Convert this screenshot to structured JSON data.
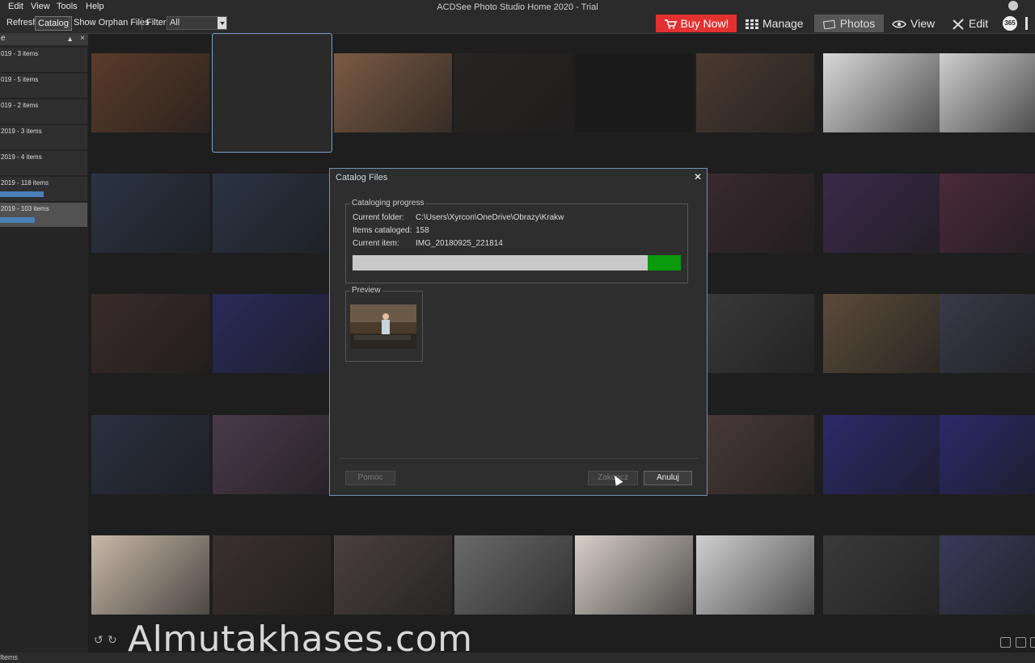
{
  "menu": [
    "Edit",
    "View",
    "Tools",
    "Help"
  ],
  "app_title": "ACDSee Photo Studio Home 2020 - Trial",
  "toolbar": {
    "refresh": "Refresh",
    "catalog": "Catalog",
    "orphan": "Show Orphan Files",
    "filter_label": "Filter",
    "filter_value": "All"
  },
  "modes": {
    "buy": "Buy Now!",
    "manage": "Manage",
    "photos": "Photos",
    "view": "View",
    "edit": "Edit",
    "badge": "365"
  },
  "sidebar": {
    "header": "e",
    "items": [
      {
        "label": "019 - 3 items",
        "progress": 0
      },
      {
        "label": "019 - 5 items",
        "progress": 0
      },
      {
        "label": "019 - 2 items",
        "progress": 0
      },
      {
        "label": "2019 - 3 items",
        "progress": 0
      },
      {
        "label": "2019 - 4 items",
        "progress": 0
      },
      {
        "label": "2019 - 118 items",
        "progress": 0.5
      },
      {
        "label": "2019 - 103 items",
        "progress": 0.4
      }
    ]
  },
  "dialog": {
    "title": "Catalog Files",
    "group_title": "Cataloging progress",
    "rows": [
      {
        "label": "Current folder:",
        "value": "C:\\Users\\Xyrcon\\OneDrive\\Obrazy\\Krakw"
      },
      {
        "label": "Items cataloged:",
        "value": "158"
      },
      {
        "label": "Current item:",
        "value": "IMG_20180925_221814"
      }
    ],
    "progress": 0.9,
    "preview_title": "Preview",
    "buttons": {
      "help": "Pomoc",
      "finish": "Zakończ",
      "cancel": "Anuluj"
    }
  },
  "watermark": "Almutakhases.com",
  "status": "Items",
  "colors": {
    "accent": "#e23131",
    "progress": "#0b9a0b",
    "selection": "#7aa0c8"
  }
}
